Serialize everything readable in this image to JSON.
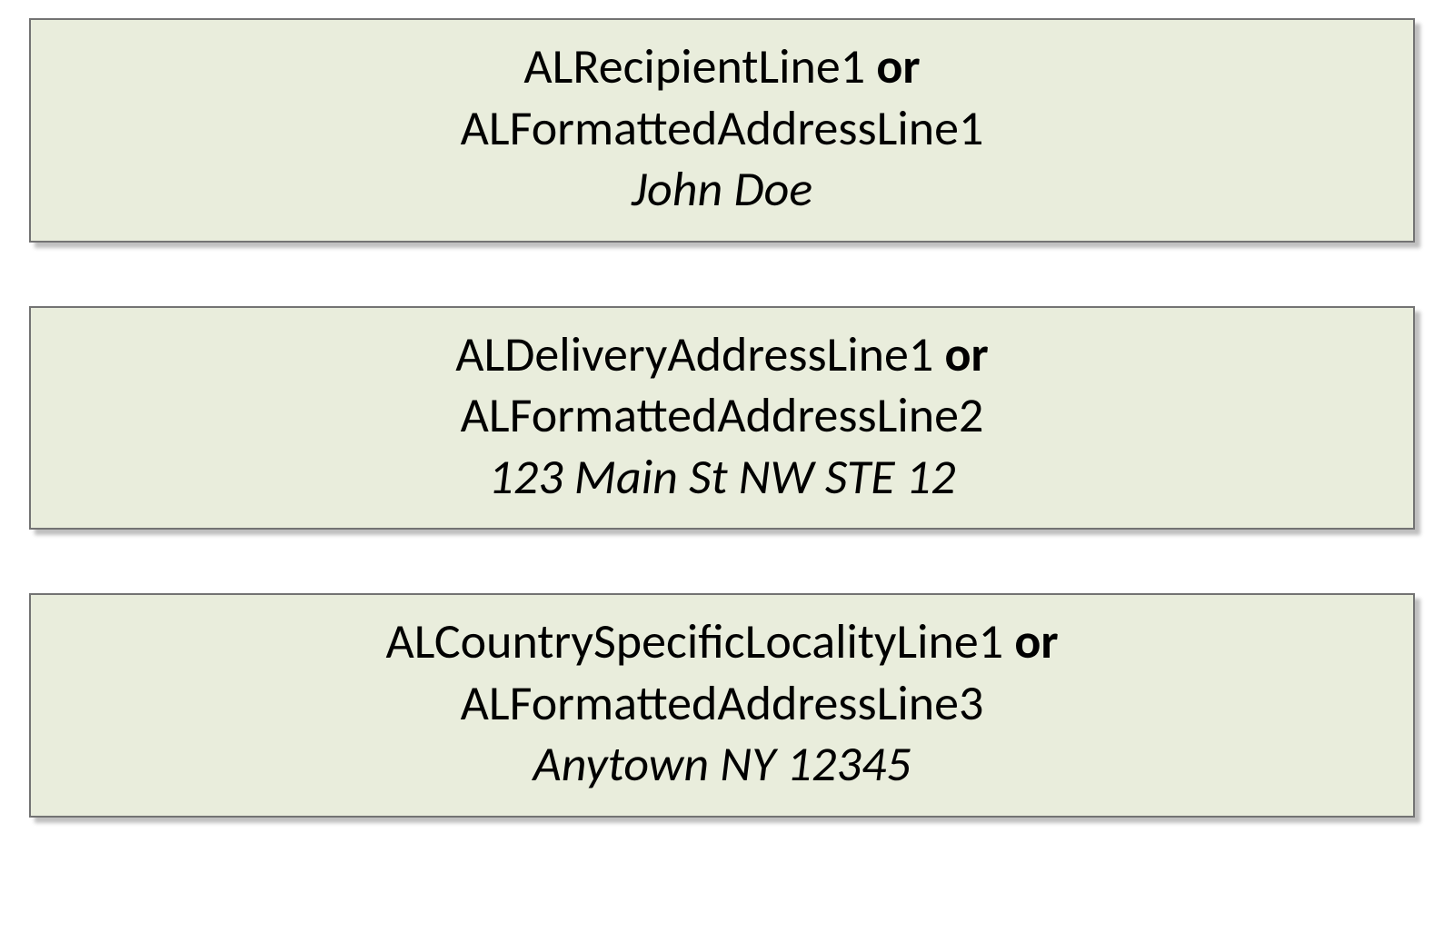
{
  "blocks": [
    {
      "label_primary": "ALRecipientLine1",
      "or_word": "or",
      "label_secondary": "ALFormattedAddressLine1",
      "example": "John Doe"
    },
    {
      "label_primary": "ALDeliveryAddressLine1",
      "or_word": "or",
      "label_secondary": "ALFormattedAddressLine2",
      "example": "123 Main St NW STE 12"
    },
    {
      "label_primary": "ALCountrySpecificLocalityLine1",
      "or_word": "or",
      "label_secondary": "ALFormattedAddressLine3",
      "example": "Anytown NY 12345"
    }
  ]
}
